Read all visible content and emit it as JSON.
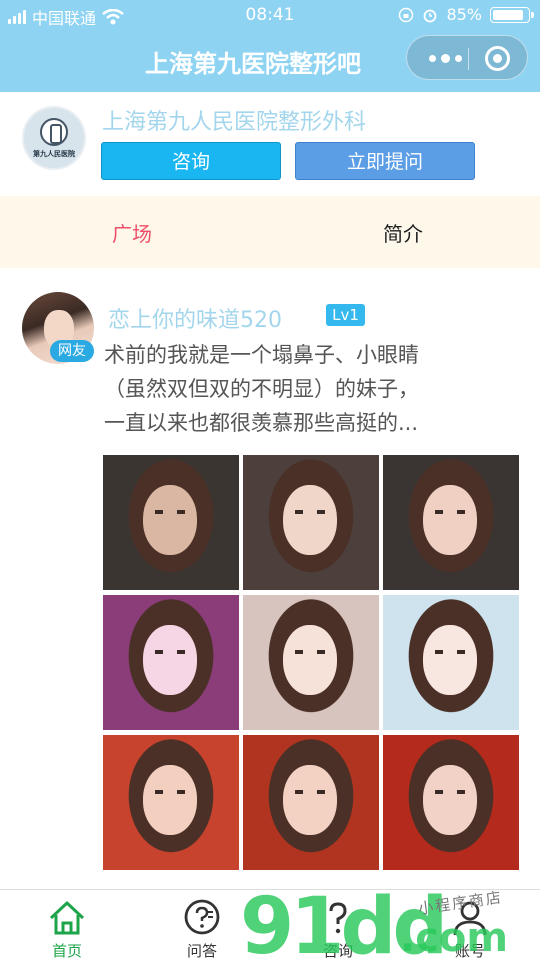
{
  "status_bar": {
    "carrier": "中国联通",
    "time": "08:41",
    "battery": "85%",
    "battery_level": 0.85
  },
  "nav": {
    "title": "上海第九医院整形吧"
  },
  "header": {
    "hospital_name": "上海第九人民医院整形外科",
    "logo_text": "第九人民医院",
    "consult_button": "咨询",
    "ask_button": "立即提问"
  },
  "tabs": {
    "square": "广场",
    "intro": "简介"
  },
  "post": {
    "username": "恋上你的味道520",
    "level": "Lv1",
    "user_badge": "网友",
    "text_lines": [
      "术前的我就是一个塌鼻子、小眼睛",
      "（虽然双但双的不明显）的妹子，",
      "一直以来也都很羡慕那些高挺的..."
    ],
    "photos": [
      {
        "bg": "#3b3532",
        "skin": "#d9b7a3"
      },
      {
        "bg": "#4c3f3c",
        "skin": "#f0d6c8"
      },
      {
        "bg": "#3a3533",
        "skin": "#efd0c2"
      },
      {
        "bg": "#8a3d78",
        "skin": "#f6d6e4"
      },
      {
        "bg": "#d7c4be",
        "skin": "#f7e2da"
      },
      {
        "bg": "#cfe3ef",
        "skin": "#f8e6e0"
      },
      {
        "bg": "#c7432e",
        "skin": "#f3cfc0"
      },
      {
        "bg": "#b0341f",
        "skin": "#f3d2c3"
      },
      {
        "bg": "#b42a1c",
        "skin": "#f2d2c6"
      }
    ]
  },
  "tabbar": {
    "home": "首页",
    "qa": "问答",
    "consult": "咨询",
    "account": "账号"
  },
  "watermark": {
    "brand": "91dd",
    "suffix": ".com",
    "shop": "小程序商店"
  },
  "colors": {
    "accent": "#8fd3f3",
    "active_tab": "#1ea44a",
    "tab_highlight": "#ee4e6a"
  }
}
